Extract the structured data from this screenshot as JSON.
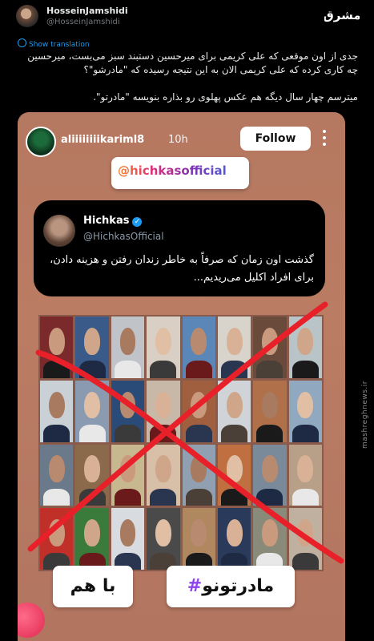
{
  "header": {
    "author_name": "HosseinJamshidi",
    "author_handle": "@HosseinJamshidi",
    "watermark_logo_text": "مشرق",
    "side_watermark": "mashreghnews.ir"
  },
  "translate_label": "Show translation",
  "tweet": {
    "line1": "جدی از اون موقعی که علی کریمی برای میرحسین دستبند سبز می‌بست، میرحسین چه کاری کرده که علی کریمی الان به این نتیجه رسیده که \"مادرشو\"؟",
    "line2": "میترسم چهار سال دیگه هم عکس پهلوی رو بذاره بنویسه \"مادرتو\"."
  },
  "story": {
    "username": "aliiiiiiiikariml8",
    "time": "10h",
    "follow_label": "Follow",
    "mention_sticker": "@hichkasofficial",
    "quote": {
      "name": "Hichkas",
      "verified_mark": "✓",
      "handle": "@HichkasOfficial",
      "text": "گذشت اون زمان که صرفاً به خاطر زندان رفتن و هزینه دادن، برای افراد اکلیل می‌ریدیم..."
    },
    "tag_left": "با هم",
    "tag_right_hash": "#",
    "tag_right_text": "مادرتونو",
    "cross_color": "#e8202a"
  },
  "colors": {
    "background": "#000000",
    "link_blue": "#1d9bf0",
    "story_bg": "#b57860"
  }
}
